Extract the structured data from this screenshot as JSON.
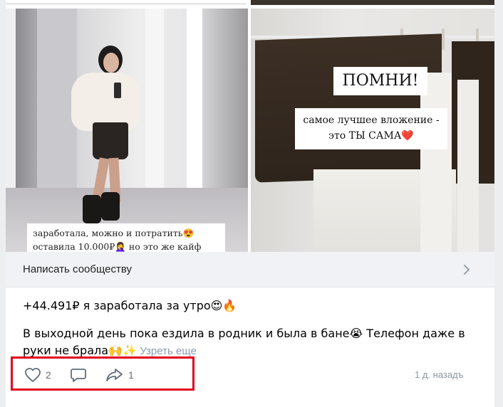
{
  "photos": {
    "left_caption_line1": "заработала, можно и потратить😍",
    "left_caption_line2": "оставила 10.000₽🤦‍♀️ но это же кайф",
    "right_sign_title": "ПОМНИ!",
    "right_sign_line1": "самое лучшее вложение -",
    "right_sign_line2": "это ТЫ САМА",
    "right_sign_heart": "❤️"
  },
  "community": {
    "label": "Написать сообществу"
  },
  "post": {
    "title": "+44.491₽ я заработала за утро😍🔥",
    "body": "В выходной день пока ездила в родник и была в бане😭 Телефон даже в руки не брала🙌✨",
    "show_more": "Узреть еще"
  },
  "actions": {
    "likes": "2",
    "shares": "1",
    "time": "1 д. назадъ"
  },
  "colors": {
    "highlight": "#e0001b",
    "icon": "#626d7a"
  }
}
